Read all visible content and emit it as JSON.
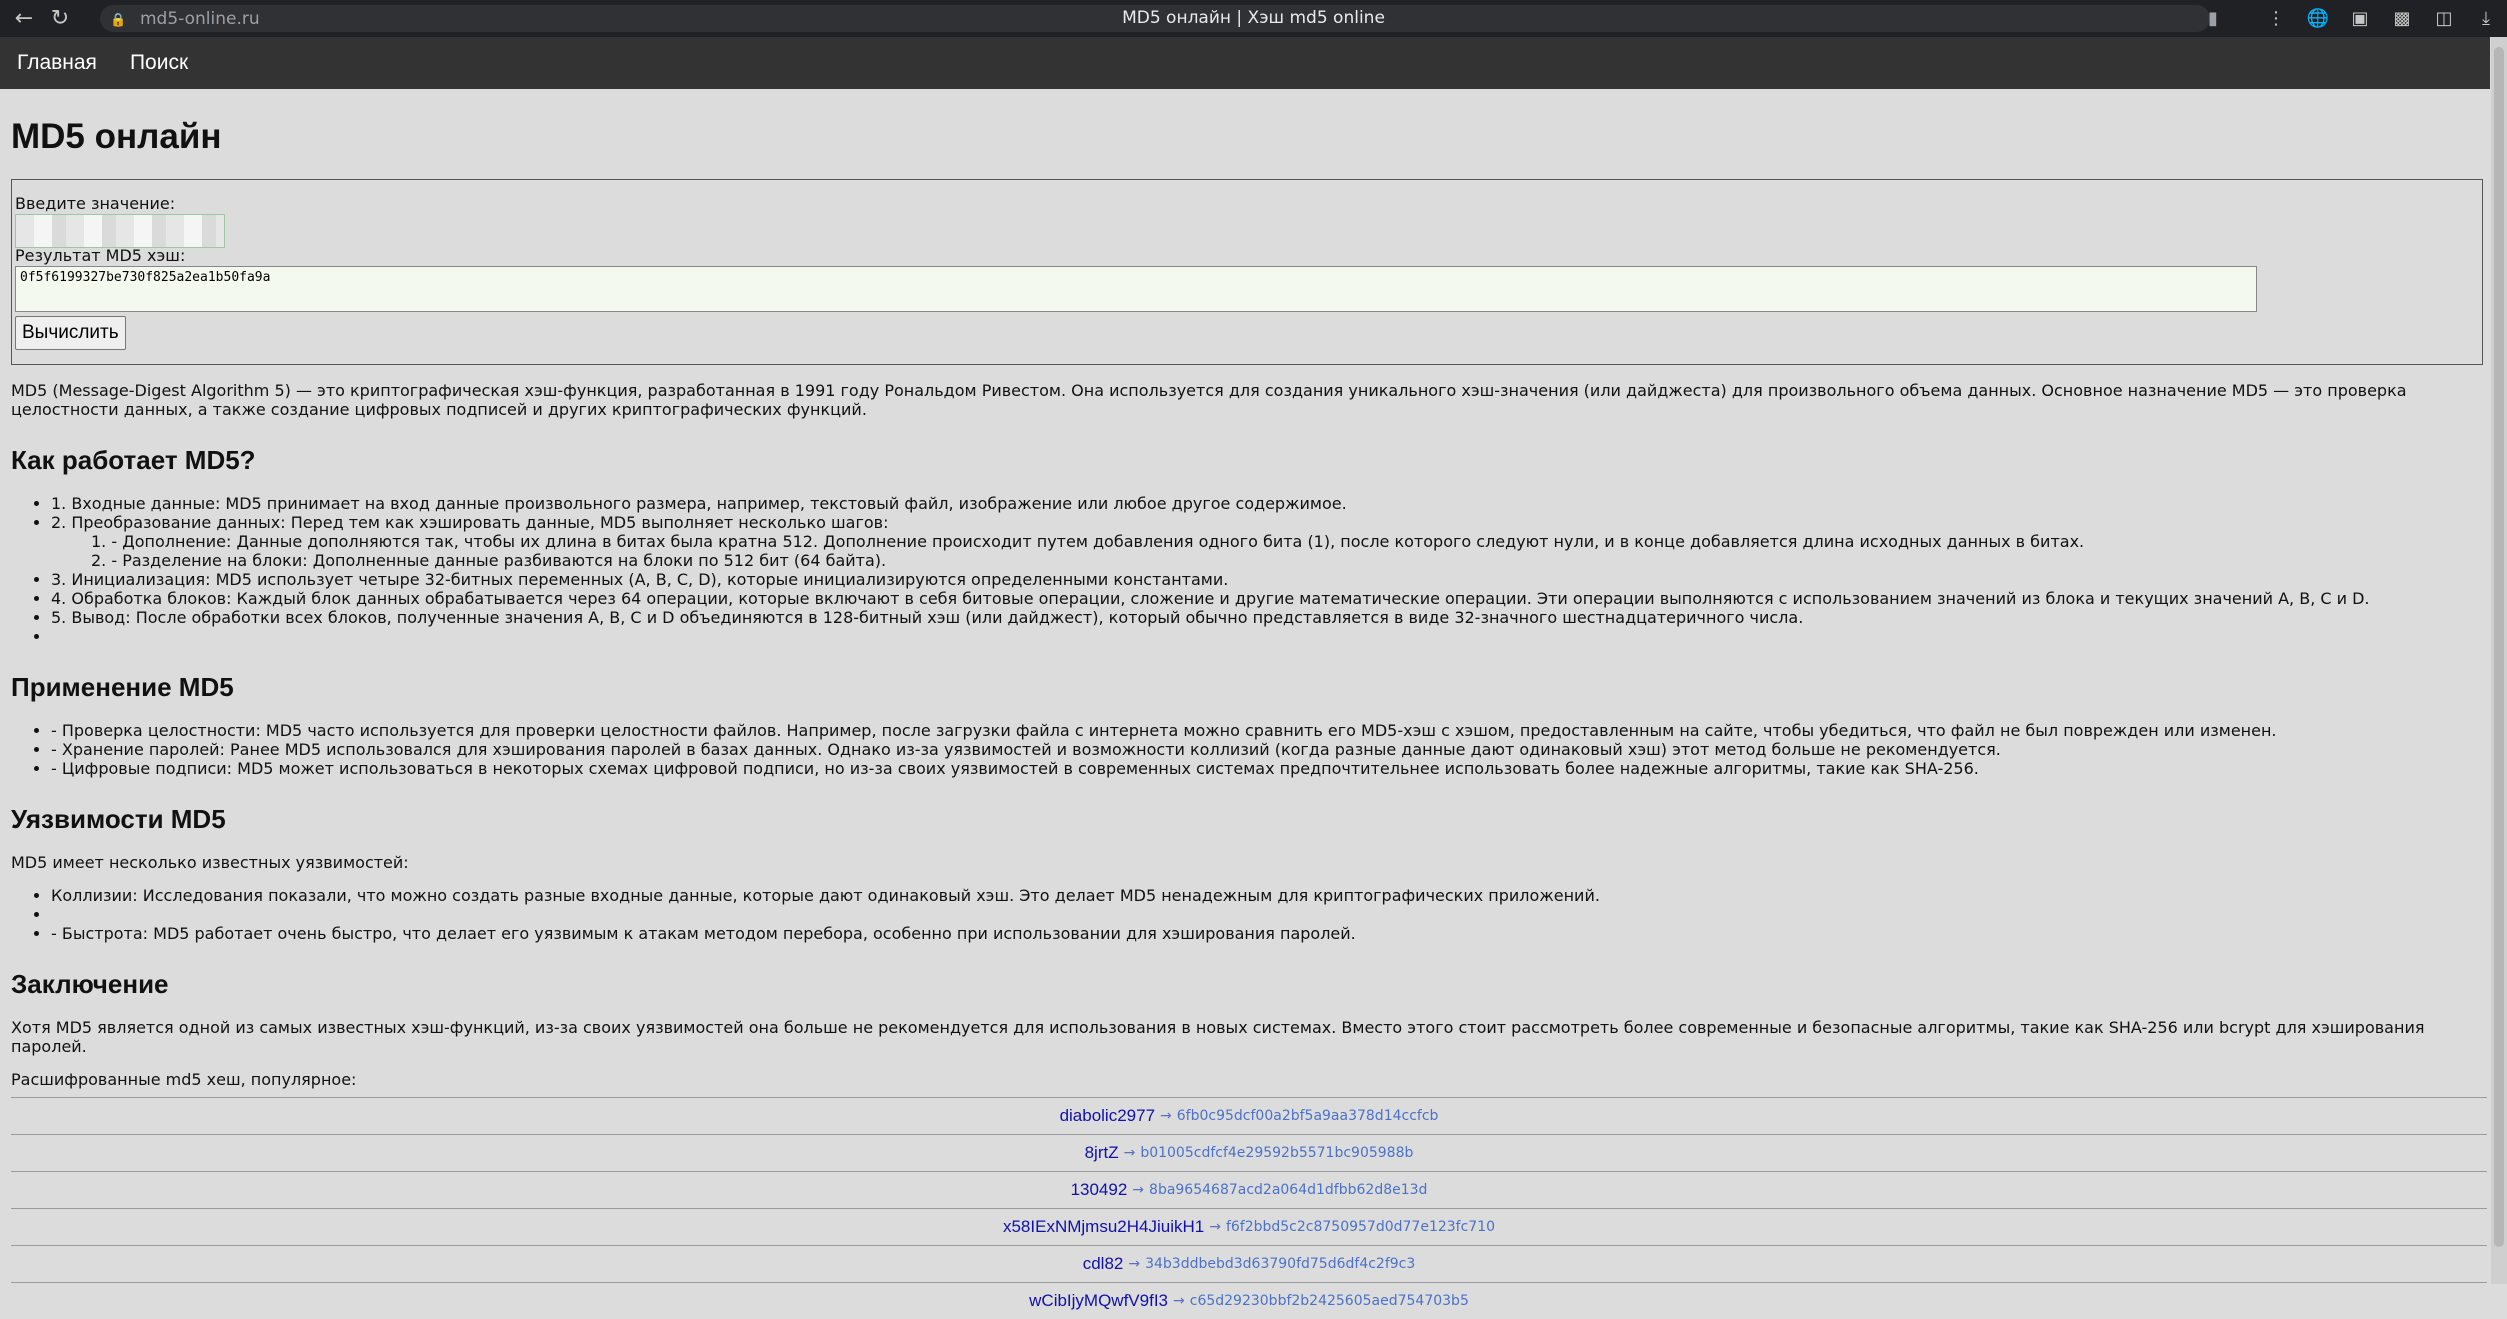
{
  "browser": {
    "url": "md5-online.ru",
    "tab_title": "MD5 онлайн | Хэш md5 online"
  },
  "nav": {
    "home": "Главная",
    "search": "Поиск"
  },
  "page": {
    "h1": "MD5 онлайн",
    "form": {
      "input_label": "Введите значение:",
      "result_label": "Результат MD5 хэш:",
      "result_value": "0f5f6199327be730f825a2ea1b50fa9a",
      "button": "Вычислить"
    },
    "intro": "MD5 (Message-Digest Algorithm 5) — это криптографическая хэш-функция, разработанная в 1991 году Рональдом Ривестом. Она используется для создания уникального хэш-значения (или дайджеста) для произвольного объема данных. Основное назначение MD5 — это проверка целостности данных, а также создание цифровых подписей и других криптографических функций.",
    "how": {
      "title": "Как работает MD5?",
      "items": [
        "1. Входные данные: MD5 принимает на вход данные произвольного размера, например, текстовый файл, изображение или любое другое содержимое.",
        "2. Преобразование данных: Перед тем как хэшировать данные, MD5 выполняет несколько шагов:"
      ],
      "subitems": [
        "1. - Дополнение: Данные дополняются так, чтобы их длина в битах была кратна 512. Дополнение происходит путем добавления одного бита (1), после которого следуют нули, и в конце добавляется длина исходных данных в битах.",
        "2. - Разделение на блоки: Дополненные данные разбиваются на блоки по 512 бит (64 байта)."
      ],
      "items_after": [
        "3. Инициализация: MD5 использует четыре 32-битных переменных (A, B, C, D), которые инициализируются определенными константами.",
        "4. Обработка блоков: Каждый блок данных обрабатывается через 64 операции, которые включают в себя битовые операции, сложение и другие математические операции. Эти операции выполняются с использованием значений из блока и текущих значений A, B, C и D.",
        "5. Вывод: После обработки всех блоков, полученные значения A, B, C и D объединяются в 128-битный хэш (или дайджест), который обычно представляется в виде 32-значного шестнадцатеричного числа.",
        ""
      ]
    },
    "usage": {
      "title": "Применение MD5",
      "items": [
        "- Проверка целостности: MD5 часто используется для проверки целостности файлов. Например, после загрузки файла с интернета можно сравнить его MD5-хэш с хэшом, предоставленным на сайте, чтобы убедиться, что файл не был поврежден или изменен.",
        "- Хранение паролей: Ранее MD5 использовался для хэширования паролей в базах данных. Однако из-за уязвимостей и возможности коллизий (когда разные данные дают одинаковый хэш) этот метод больше не рекомендуется.",
        "- Цифровые подписи: MD5 может использоваться в некоторых схемах цифровой подписи, но из-за своих уязвимостей в современных системах предпочтительнее использовать более надежные алгоритмы, такие как SHA-256."
      ]
    },
    "vuln": {
      "title": "Уязвимости MD5",
      "intro": "MD5 имеет несколько известных уязвимостей:",
      "items": [
        "Коллизии: Исследования показали, что можно создать разные входные данные, которые дают одинаковый хэш. Это делает MD5 ненадежным для криптографических приложений.",
        "",
        "- Быстрота: MD5 работает очень быстро, что делает его уязвимым к атакам методом перебора, особенно при использовании для хэширования паролей."
      ]
    },
    "conclusion": {
      "title": "Заключение",
      "text": "Хотя MD5 является одной из самых известных хэш-функций, из-за своих уязвимостей она больше не рекомендуется для использования в новых системах. Вместо этого стоит рассмотреть более современные и безопасные алгоритмы, такие как SHA-256 или bcrypt для хэширования паролей."
    },
    "popular_label": "Расшифрованные md5 хеш, популярное:",
    "popular": [
      {
        "word": "diabolic2977",
        "hash": "6fb0c95dcf00a2bf5a9aa378d14ccfcb"
      },
      {
        "word": "8jrtZ",
        "hash": "b01005cdfcf4e29592b5571bc905988b"
      },
      {
        "word": "130492",
        "hash": "8ba9654687acd2a064d1dfbb62d8e13d"
      },
      {
        "word": "x58IExNMjmsu2H4JiuikH1",
        "hash": "f6f2bbd5c2c8750957d0d77e123fc710"
      },
      {
        "word": "cdl82",
        "hash": "34b3ddbebd3d63790fd75d6df4c2f9c3"
      },
      {
        "word": "wCibIjyMQwfV9fI3",
        "hash": "c65d29230bbf2b2425605aed754703b5"
      }
    ],
    "arrow": "→"
  }
}
